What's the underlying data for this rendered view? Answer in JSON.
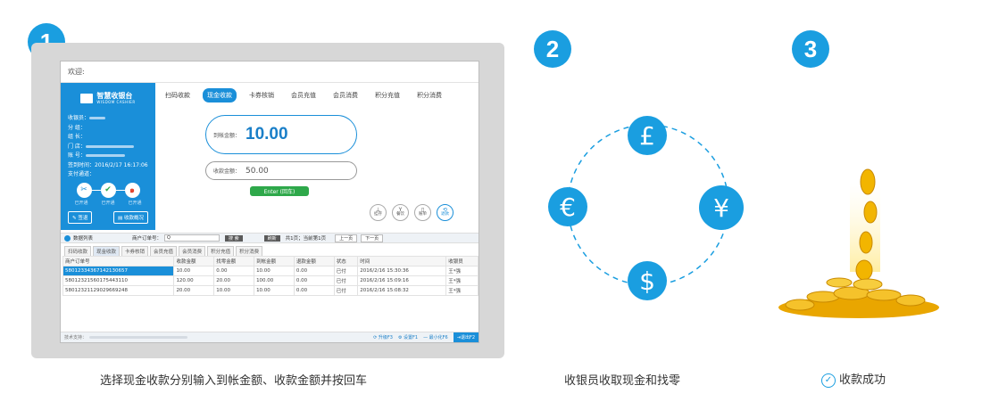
{
  "steps": [
    "1",
    "2",
    "3"
  ],
  "screen": {
    "welcome": "欢迎:",
    "logo": {
      "title": "智慧收银台",
      "subtitle": "WISDOM CASHIER"
    },
    "info": [
      {
        "label": "收银员："
      },
      {
        "label": "分 组："
      },
      {
        "label": "组 长："
      },
      {
        "label": "门 店："
      },
      {
        "label": "账 号："
      },
      {
        "label": "签到时间：2016/2/17 16:17:06"
      },
      {
        "label": "支付通道："
      }
    ],
    "pay_status": [
      "已开通",
      "已开通",
      "已开通"
    ],
    "side_buttons": {
      "sign_out": "签退",
      "overview": "收款概况"
    },
    "tabs": [
      "扫码收款",
      "现金收款",
      "卡券核销",
      "会员充值",
      "会员消费",
      "积分充值",
      "积分消费"
    ],
    "amount": {
      "label": "到帐金额：",
      "value": "10.00"
    },
    "received": {
      "label": "收款金额：",
      "value": "50.00"
    },
    "enter": "Enter (回车)",
    "tools": [
      "挂存",
      "餐饮",
      "账单",
      "退款"
    ],
    "list": {
      "title": "数据列表",
      "order_label": "商户订单号：",
      "order_placeholder": "Q",
      "query": "搜 索",
      "refresh": "刷新",
      "page_info": "共1页；当前第1页",
      "prev": "上一页",
      "next": "下一页"
    },
    "sub_tabs": [
      "扫码收款",
      "现金收款",
      "卡券核销",
      "会员充值",
      "会员消费",
      "积分充值",
      "积分消费"
    ],
    "table": {
      "headers": [
        "商户订单号",
        "收款金额",
        "找零金额",
        "到帐金额",
        "退款金额",
        "状态",
        "时间",
        "收银员"
      ],
      "rows": [
        [
          "580123343671421306​57",
          "10.00",
          "0.00",
          "10.00",
          "0.00",
          "已付",
          "2016/2/16 15:30:36",
          "王*强"
        ],
        [
          "58012321560175443110",
          "120.00",
          "20.00",
          "100.00",
          "0.00",
          "已付",
          "2016/2/16 15:09:16",
          "王*强"
        ],
        [
          "58012321129029669248",
          "20.00",
          "10.00",
          "10.00",
          "0.00",
          "已付",
          "2016/2/16 15:08:32",
          "王*强"
        ]
      ]
    },
    "footer": {
      "tech": "技术支持：",
      "upgrade": "升级F3",
      "settings": "设置F1",
      "minimize": "最小化F6",
      "exit": "退出F2"
    }
  },
  "currencies": [
    "£",
    "¥",
    "$",
    "€"
  ],
  "captions": {
    "step1": "选择现金收款分别输入到帐金额、收款金额并按回车",
    "step2": "收银员收取现金和找零",
    "step3": "收款成功"
  },
  "colors": {
    "accent": "#1a9ee0",
    "enter": "#2ea84a",
    "coin": "#f2b500"
  }
}
